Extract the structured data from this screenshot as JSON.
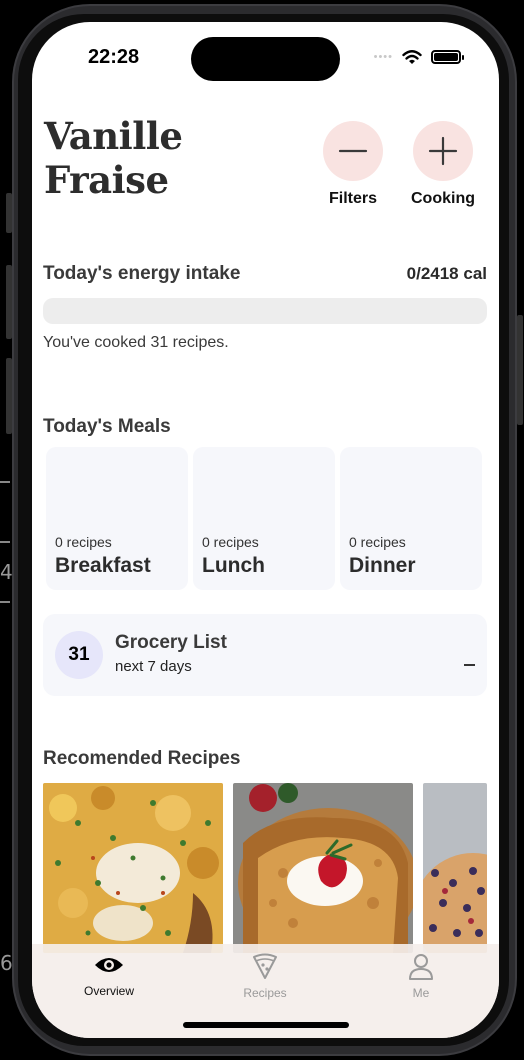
{
  "status_bar": {
    "time": "22:28",
    "signal": "••••"
  },
  "brand": {
    "line1": "Vanille",
    "line2": "Fraise"
  },
  "actions": {
    "filters_label": "Filters",
    "cooking_label": "Cooking"
  },
  "energy": {
    "title": "Today's energy intake",
    "value": "0/2418 cal",
    "consumed": 0,
    "goal": 2418,
    "progress_fraction": 0,
    "note": "You've cooked 31 recipes."
  },
  "meals": {
    "title": "Today's Meals",
    "items": [
      {
        "count": "0 recipes",
        "name": "Breakfast"
      },
      {
        "count": "0 recipes",
        "name": "Lunch"
      },
      {
        "count": "0 recipes",
        "name": "Dinner"
      }
    ]
  },
  "grocery": {
    "count": "31",
    "title": "Grocery List",
    "subtitle": "next 7 days"
  },
  "recommended": {
    "title": "Recomended Recipes"
  },
  "tab_bar": {
    "items": [
      {
        "label": "Overview",
        "icon": "eye-icon",
        "active": true
      },
      {
        "label": "Recipes",
        "icon": "pizza-slice-icon",
        "active": false
      },
      {
        "label": "Me",
        "icon": "person-icon",
        "active": false
      }
    ]
  },
  "colors": {
    "accent": "#f9e3e1",
    "card_bg": "#f6f7fb",
    "badge_bg": "#e6e6fa",
    "progress_track": "#ededed"
  }
}
